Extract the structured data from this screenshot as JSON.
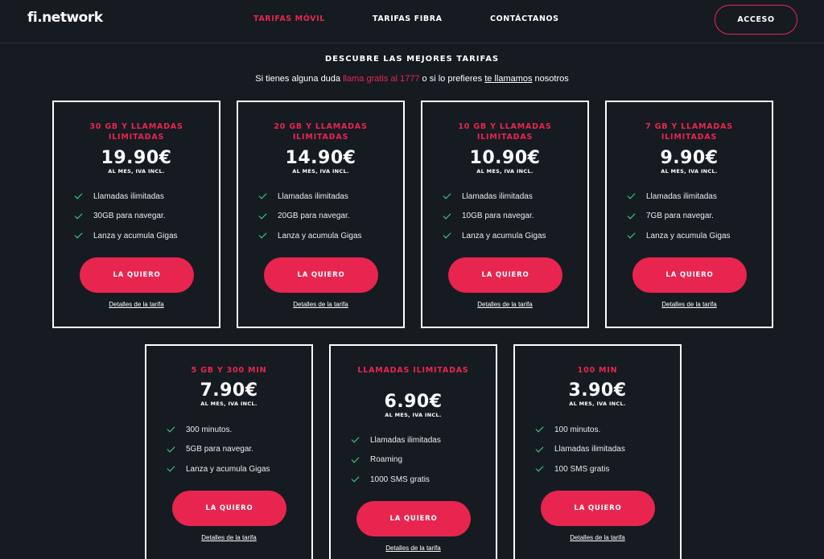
{
  "header": {
    "logo": "fi.network",
    "nav": [
      "TARIFAS MÓVIL",
      "TARIFAS FIBRA",
      "CONTÁCTANOS"
    ],
    "acceso": "ACCESO"
  },
  "intro": {
    "title": "DESCUBRE LAS MEJORES TARIFAS",
    "subtitle_pre": "Si tienes alguna duda ",
    "subtitle_call": "llama gratis al 1777",
    "subtitle_mid": " o si lo prefieres ",
    "subtitle_link": "te llamamos",
    "subtitle_post": " nosotros"
  },
  "cards": [
    {
      "title": "30 GB Y LLAMADAS ILIMITADAS",
      "price": "19.90€",
      "price_note": "AL MES, IVA INCL.",
      "features": [
        "Llamadas ilimitadas",
        "30GB para navegar.",
        "Lanza y acumula Gigas"
      ],
      "button": "LA QUIERO",
      "details": "Detalles de la tarifa"
    },
    {
      "title": "20 GB Y LLAMADAS ILIMITADAS",
      "price": "14.90€",
      "price_note": "AL MES, IVA INCL.",
      "features": [
        "Llamadas ilimitadas",
        "20GB para navegar.",
        "Lanza y acumula Gigas"
      ],
      "button": "LA QUIERO",
      "details": "Detalles de la tarifa"
    },
    {
      "title": "10 GB Y LLAMADAS ILIMITADAS",
      "price": "10.90€",
      "price_note": "AL MES, IVA INCL.",
      "features": [
        "Llamadas ilimitadas",
        "10GB para navegar.",
        "Lanza y acumula Gigas"
      ],
      "button": "LA QUIERO",
      "details": "Detalles de la tarifa"
    },
    {
      "title": "7 GB Y LLAMADAS ILIMITADAS",
      "price": "9.90€",
      "price_note": "AL MES, IVA INCL.",
      "features": [
        "Llamadas ilimitadas",
        "7GB para navegar.",
        "Lanza y acumula Gigas"
      ],
      "button": "LA QUIERO",
      "details": "Detalles de la tarifa"
    },
    {
      "title": "5 GB Y 300 MIN",
      "price": "7.90€",
      "price_note": "AL MES, IVA INCL.",
      "features": [
        "300 minutos.",
        "5GB para navegar.",
        "Lanza y acumula Gigas"
      ],
      "button": "LA QUIERO",
      "details": "Detalles de la tarifa"
    },
    {
      "title": "LLAMADAS ILIMITADAS",
      "price": "6.90€",
      "price_note": "AL MES, IVA INCL.",
      "features": [
        "Llamadas ilimitadas",
        "Roaming",
        "1000 SMS gratis"
      ],
      "button": "LA QUIERO",
      "details": "Detalles de la tarifa"
    },
    {
      "title": "100 MIN",
      "price": "3.90€",
      "price_note": "AL MES, IVA INCL.",
      "features": [
        "100 minutos.",
        "Llamadas ilimitadas",
        "100 SMS gratis"
      ],
      "button": "LA QUIERO",
      "details": "Detalles de la tarifa"
    }
  ],
  "colors": {
    "accent": "#e8254f",
    "background": "#161b22",
    "check": "#3ddc84"
  }
}
